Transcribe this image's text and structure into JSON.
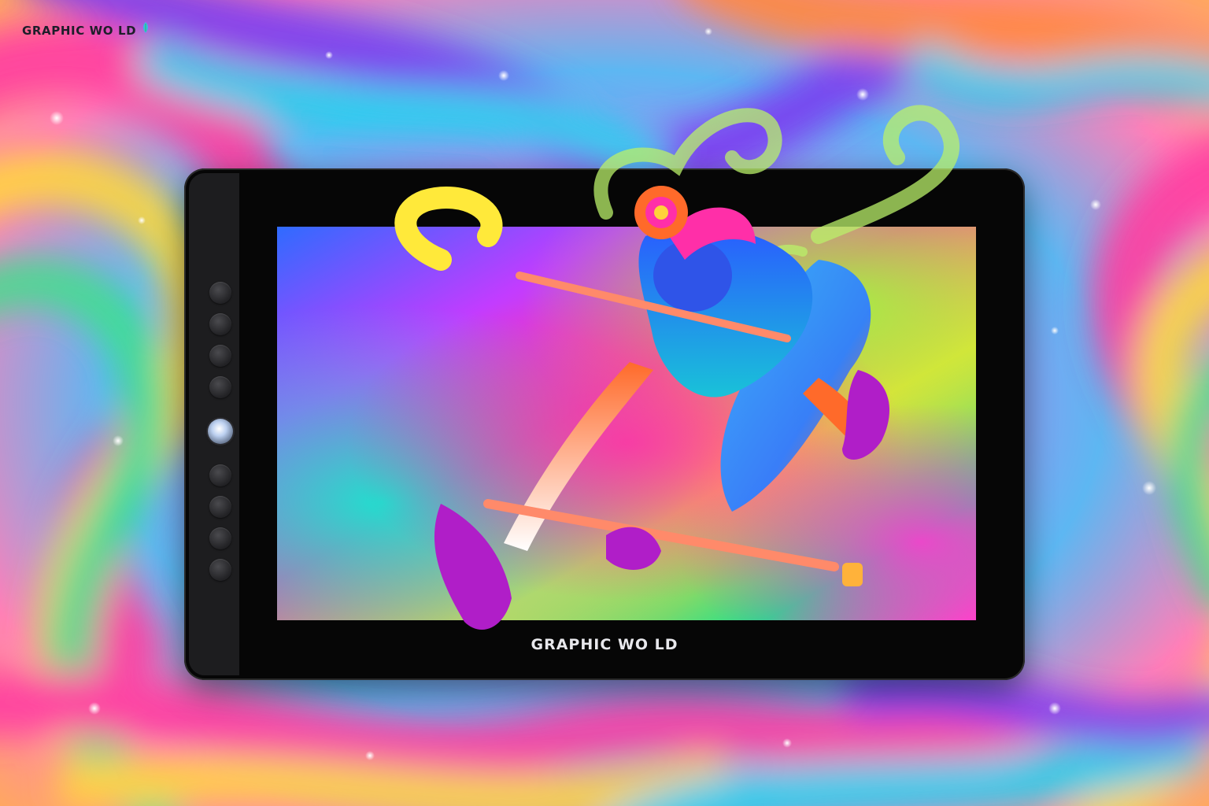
{
  "brand": {
    "corner_logo_text": "GRAPHIC WO LD",
    "bezel_logo_text": "GRAPHIC WO LD",
    "leaf_icon": "leaf-icon"
  },
  "tablet": {
    "upper_keys": 4,
    "lower_keys": 4,
    "dial": "dial-icon"
  },
  "colors": {
    "tablet_body": "#060606",
    "side_panel": "#1d1d1f",
    "logo_dark": "#1e1e2a",
    "logo_light": "#e8e8ec"
  }
}
